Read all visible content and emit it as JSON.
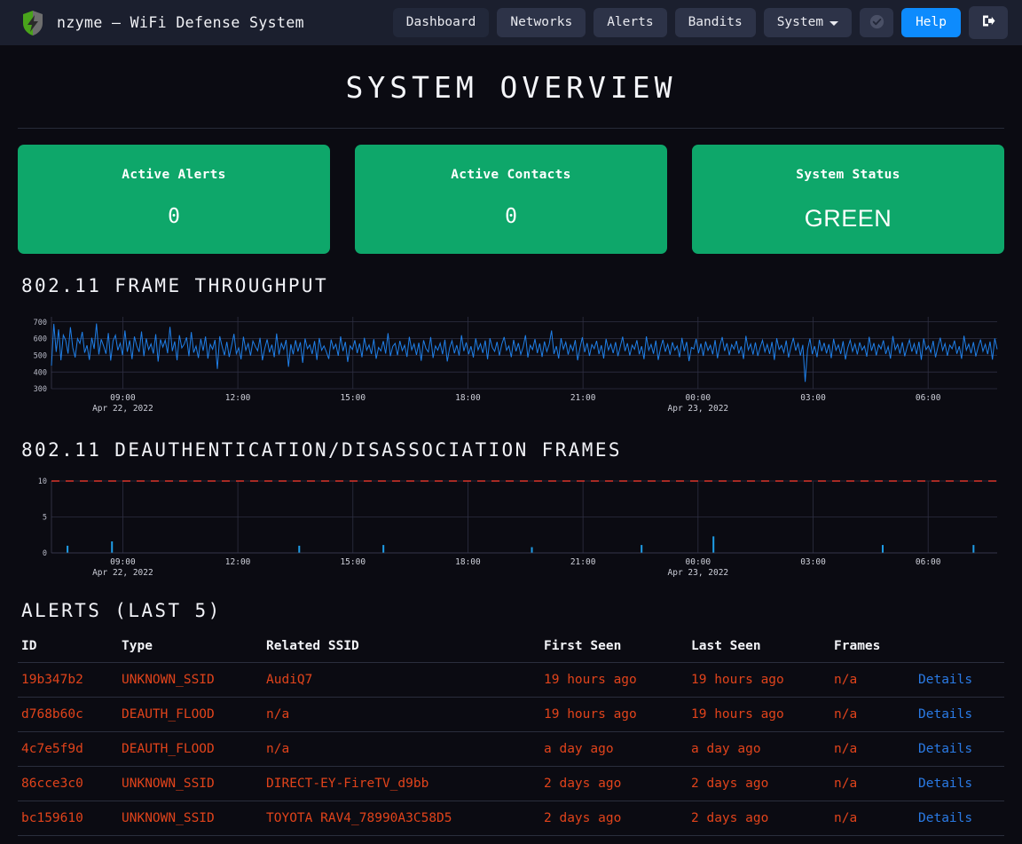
{
  "navbar": {
    "brand_title": "nzyme – WiFi Defense System",
    "logo_icon": "shield-bolt-icon",
    "items": [
      {
        "label": "Dashboard",
        "active": true
      },
      {
        "label": "Networks",
        "active": false
      },
      {
        "label": "Alerts",
        "active": false
      },
      {
        "label": "Bandits",
        "active": false
      },
      {
        "label": "System",
        "active": false,
        "caret": true
      }
    ],
    "status_icon": "check-circle-icon",
    "help_label": "Help",
    "logout_icon": "sign-out-icon",
    "help_color": "#0d8bfd"
  },
  "header": {
    "title": "SYSTEM OVERVIEW"
  },
  "cards": [
    {
      "title": "Active Alerts",
      "value": "0",
      "color": "#0ea76a",
      "mono": true
    },
    {
      "title": "Active Contacts",
      "value": "0",
      "color": "#0ea76a",
      "mono": true
    },
    {
      "title": "System Status",
      "value": "GREEN",
      "color": "#0ea76a",
      "mono": false
    }
  ],
  "sections": {
    "throughput_title": "802.11 FRAME THROUGHPUT",
    "deauth_title": "802.11 DEAUTHENTICATION/DISASSOCIATION FRAMES"
  },
  "chart_data": [
    {
      "type": "line",
      "title": "802.11 FRAME THROUGHPUT",
      "xlabel": "",
      "ylabel": "",
      "grid": true,
      "legend": null,
      "line_color": "#1f7fe8",
      "ylim": [
        300,
        730
      ],
      "yticks": [
        300,
        400,
        500,
        600,
        700
      ],
      "xticks": [
        "09:00",
        "12:00",
        "15:00",
        "18:00",
        "21:00",
        "00:00",
        "03:00",
        "06:00"
      ],
      "xtick_sublabels": {
        "09:00": "Apr 22, 2022",
        "00:00": "Apr 23, 2022"
      },
      "values": [
        438,
        688,
        520,
        655,
        470,
        621,
        590,
        510,
        668,
        545,
        487,
        600,
        571,
        640,
        515,
        560,
        472,
        605,
        538,
        690,
        505,
        596,
        556,
        509,
        633,
        468,
        587,
        620,
        530,
        572,
        500,
        648,
        521,
        589,
        477,
        612,
        556,
        520,
        642,
        495,
        601,
        534,
        568,
        510,
        626,
        462,
        595,
        549,
        590,
        512,
        670,
        525,
        583,
        470,
        620,
        544,
        566,
        607,
        495,
        639,
        516,
        555,
        484,
        598,
        527,
        612,
        480,
        566,
        536,
        592,
        418,
        614,
        553,
        500,
        580,
        490,
        556,
        628,
        510,
        544,
        476,
        611,
        530,
        570,
        498,
        585,
        553,
        527,
        604,
        470,
        541,
        595,
        517,
        563,
        489,
        630,
        504,
        572,
        536,
        592,
        431,
        566,
        506,
        590,
        522,
        578,
        455,
        600,
        539,
        562,
        508,
        585,
        472,
        603,
        530,
        556,
        520,
        478,
        594,
        538,
        566,
        497,
        613,
        525,
        580,
        460,
        557,
        535,
        590,
        513,
        571,
        488,
        604,
        531,
        562,
        508,
        596,
        479,
        547,
        526,
        585,
        510,
        632,
        495,
        553,
        571,
        500,
        586,
        528,
        560,
        490,
        610,
        532,
        568,
        502,
        575,
        467,
        590,
        541,
        520,
        609,
        484,
        556,
        530,
        572,
        506,
        593,
        463,
        545,
        587,
        512,
        561,
        498,
        620,
        525,
        577,
        506,
        554,
        487,
        601,
        532,
        569,
        514,
        588,
        476,
        602,
        547,
        523,
        580,
        498,
        566,
        609,
        530,
        556,
        489,
        592,
        524,
        573,
        505,
        549,
        620,
        487,
        560,
        534,
        597,
        513,
        571,
        490,
        583,
        522,
        566,
        648,
        508,
        555,
        481,
        602,
        536,
        578,
        504,
        562,
        527,
        591,
        470,
        545,
        608,
        519,
        573,
        496,
        564,
        539,
        586,
        507,
        560,
        481,
        598,
        531,
        567,
        513,
        579,
        495,
        553,
        611,
        525,
        572,
        498,
        561,
        536,
        590,
        506,
        554,
        477,
        613,
        530,
        565,
        509,
        588,
        472,
        544,
        593,
        521,
        566,
        503,
        578,
        531,
        556,
        489,
        604,
        525,
        580,
        465,
        547,
        538,
        598,
        512,
        570,
        496,
        583,
        529,
        560,
        506,
        591,
        482,
        558,
        609,
        526,
        572,
        500,
        564,
        537,
        586,
        510,
        553,
        478,
        616,
        532,
        568,
        504,
        577,
        496,
        547,
        590,
        521,
        565,
        508,
        580,
        472,
        602,
        535,
        559,
        516,
        588,
        487,
        550,
        604,
        528,
        571,
        498,
        562,
        341,
        534,
        600,
        507,
        555,
        489,
        593,
        525,
        574,
        511,
        566,
        483,
        598,
        530,
        562,
        508,
        584,
        475,
        546,
        591,
        523,
        568,
        505,
        577,
        531,
        555,
        492,
        610,
        527,
        573,
        499,
        563,
        538,
        589,
        508,
        552,
        480,
        615,
        533,
        566,
        510,
        578,
        494,
        548,
        592,
        522,
        569,
        506,
        581,
        473,
        600,
        534,
        557,
        517,
        586,
        488,
        551,
        605,
        529,
        570,
        497,
        561,
        539,
        588,
        509,
        554,
        479,
        617,
        531,
        567,
        512,
        579,
        493,
        549,
        594,
        524,
        566,
        507,
        582,
        474,
        601,
        536
      ]
    },
    {
      "type": "bar",
      "title": "802.11 DEAUTHENTICATION/DISASSOCIATION FRAMES",
      "xlabel": "",
      "ylabel": "",
      "grid": true,
      "bar_color": "#1f9ee8",
      "threshold": {
        "value": 10,
        "color": "#d9342b",
        "style": "dashed"
      },
      "ylim": [
        0,
        10
      ],
      "yticks": [
        0,
        5,
        10
      ],
      "xticks": [
        "09:00",
        "12:00",
        "15:00",
        "18:00",
        "21:00",
        "00:00",
        "03:00",
        "06:00"
      ],
      "xtick_sublabels": {
        "09:00": "Apr 22, 2022",
        "00:00": "Apr 23, 2022"
      },
      "spikes": [
        {
          "x": 0.017,
          "value": 1.0
        },
        {
          "x": 0.064,
          "value": 1.6
        },
        {
          "x": 0.262,
          "value": 1.0
        },
        {
          "x": 0.351,
          "value": 1.1
        },
        {
          "x": 0.508,
          "value": 0.8
        },
        {
          "x": 0.624,
          "value": 1.1
        },
        {
          "x": 0.7,
          "value": 2.3
        },
        {
          "x": 0.879,
          "value": 1.1
        },
        {
          "x": 0.975,
          "value": 1.1
        }
      ]
    }
  ],
  "alerts": {
    "title": "ALERTS (LAST 5)",
    "columns": [
      "ID",
      "Type",
      "Related SSID",
      "First Seen",
      "Last Seen",
      "Frames",
      ""
    ],
    "details_label": "Details",
    "rows": [
      {
        "id": "19b347b2",
        "type": "UNKNOWN_SSID",
        "ssid": "AudiQ7",
        "first_seen": "19 hours ago",
        "last_seen": "19 hours ago",
        "frames": "n/a",
        "details": "Details"
      },
      {
        "id": "d768b60c",
        "type": "DEAUTH_FLOOD",
        "ssid": "n/a",
        "first_seen": "19 hours ago",
        "last_seen": "19 hours ago",
        "frames": "n/a",
        "details": "Details"
      },
      {
        "id": "4c7e5f9d",
        "type": "DEAUTH_FLOOD",
        "ssid": "n/a",
        "first_seen": "a day ago",
        "last_seen": "a day ago",
        "frames": "n/a",
        "details": "Details"
      },
      {
        "id": "86cce3c0",
        "type": "UNKNOWN_SSID",
        "ssid": "DIRECT-EY-FireTV_d9bb",
        "first_seen": "2 days ago",
        "last_seen": "2 days ago",
        "frames": "n/a",
        "details": "Details"
      },
      {
        "id": "bc159610",
        "type": "UNKNOWN_SSID",
        "ssid": "TOYOTA RAV4_78990A3C58D5",
        "first_seen": "2 days ago",
        "last_seen": "2 days ago",
        "frames": "n/a",
        "details": "Details"
      }
    ]
  }
}
